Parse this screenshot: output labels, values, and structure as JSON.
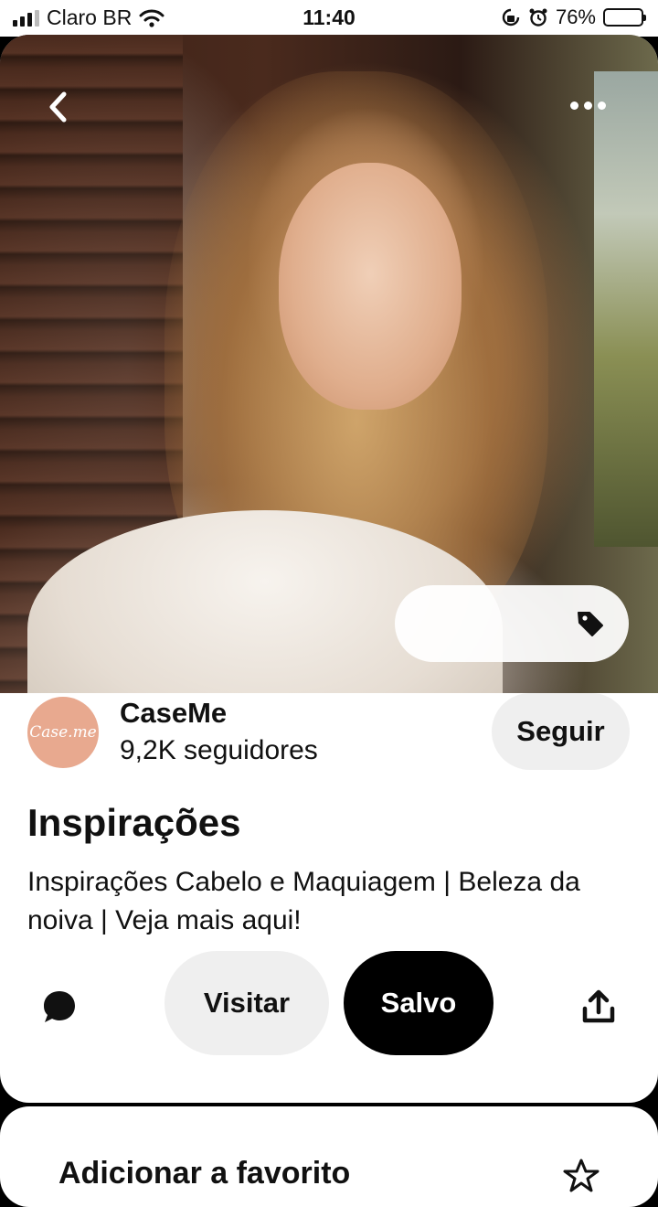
{
  "status_bar": {
    "carrier": "Claro BR",
    "time": "11:40",
    "battery": "76%",
    "battery_level": 0.76
  },
  "pin": {
    "creator": {
      "avatar_text": "Case.me",
      "name": "CaseMe",
      "followers": "9,2K seguidores",
      "follow_label": "Seguir"
    },
    "title": "Inspirações",
    "description": "Inspirações Cabelo e Maquiagem | Beleza da noiva | Veja mais aqui!",
    "actions": {
      "visit_label": "Visitar",
      "saved_label": "Salvo"
    }
  },
  "next_card": {
    "title": "Adicionar a favorito"
  },
  "icons": {
    "back": "chevron-left-icon",
    "more": "more-horizontal-icon",
    "tag": "tag-icon",
    "comment": "comment-icon",
    "share": "share-icon",
    "wifi": "wifi-icon",
    "alarm": "alarm-icon"
  },
  "colors": {
    "background": "#000000",
    "card": "#ffffff",
    "pill": "#efefef",
    "saved": "#000000",
    "avatar": "#e8a98f"
  }
}
